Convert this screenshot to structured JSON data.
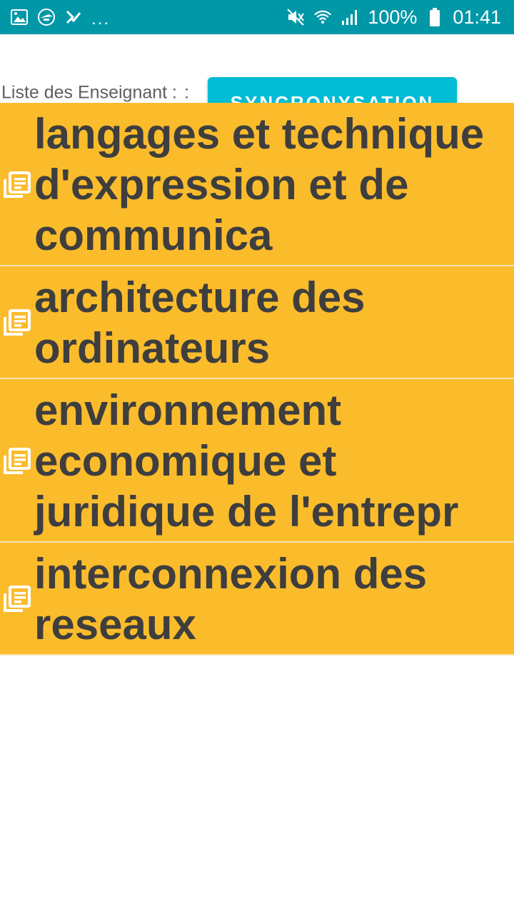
{
  "status_bar": {
    "left_icons": [
      "image-icon",
      "app-icon",
      "check-icon"
    ],
    "more": "...",
    "battery": "100%",
    "time": "01:41"
  },
  "header": {
    "label": "Liste des Enseignant :",
    "label_suffix": ":",
    "sync_button": "SYNCRONYSATION"
  },
  "list": [
    {
      "title": "langages et technique d'expression et de communica"
    },
    {
      "title": "architecture des ordinateurs"
    },
    {
      "title": "environnement economique et juridique de l'entrepr"
    },
    {
      "title": "interconnexion des reseaux"
    }
  ],
  "colors": {
    "status_bar": "#0097a7",
    "button": "#00bcd4",
    "row_background": "#fbbc2c",
    "row_text": "#3e3e3e"
  }
}
